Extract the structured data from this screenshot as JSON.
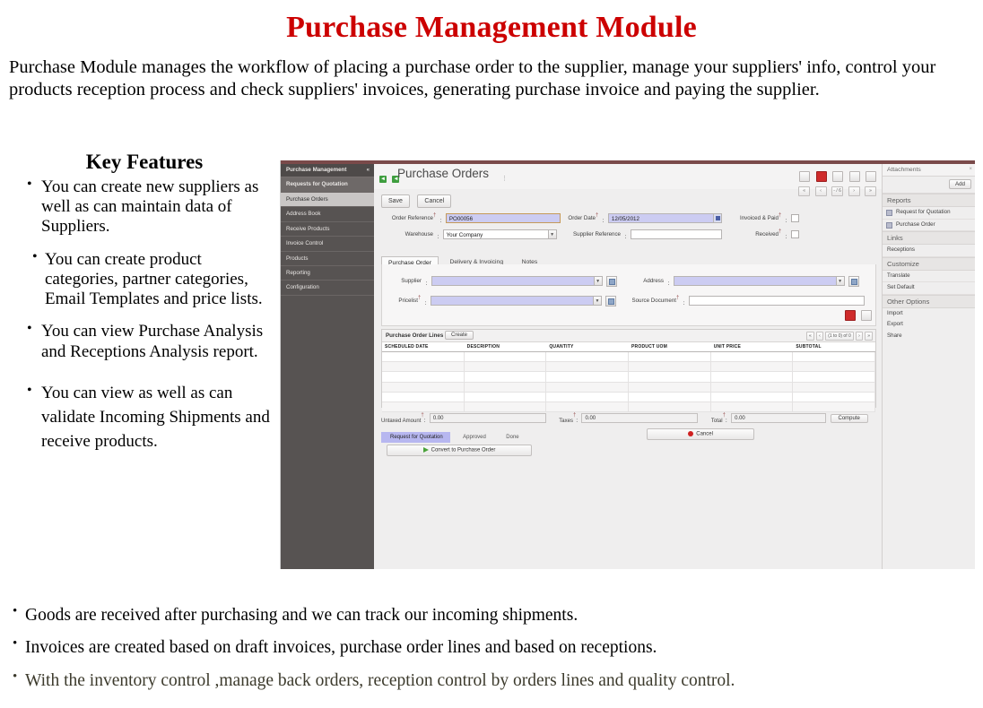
{
  "title": "Purchase Management Module",
  "intro": "Purchase Module manages the workflow of placing a purchase order to the supplier, manage your suppliers' info, control your products reception process and check suppliers' invoices, generating purchase invoice and paying the supplier.",
  "key_features": {
    "heading": "Key Features",
    "items": [
      "You can create new suppliers as well as can maintain data of Suppliers.",
      "You can create product categories, partner categories, Email Templates and price lists.",
      "You can view Purchase Analysis and Receptions  Analysis report.",
      "You can view as well as can validate Incoming Shipments and receive products."
    ]
  },
  "bottom_points": [
    "Goods are received after purchasing and we can track our incoming shipments.",
    "Invoices are created based on draft invoices, purchase order lines and based on receptions.",
    "With the inventory control ,manage back orders, reception control by orders lines and quality control."
  ],
  "colors": {
    "title_red": "#cc0000",
    "olive_text": "#3c3a2c",
    "erp_sidebar": "#575352",
    "erp_topbar": "#7a4a4a",
    "active_view": "#cf2b2b",
    "field_lilac": "#ccccf2",
    "status_active": "#b7b7f0"
  },
  "erp": {
    "sidebar": {
      "header": "Purchase Management",
      "collapse_icon": "chevron-left-icon",
      "selected": "Requests for Quotation",
      "highlight": "Purchase Orders",
      "items": [
        "Requests for Quotation",
        "Purchase Orders",
        "Address Book",
        "Receive Products",
        "Invoice Control",
        "Products",
        "Reporting",
        "Configuration"
      ]
    },
    "header": {
      "title": "Purchase Orders",
      "breadcrumb_dots": "",
      "view_buttons": [
        "list-view-icon",
        "form-view-icon",
        "calendar-view-icon",
        "graph-view-icon",
        "gantt-view-icon"
      ],
      "active_view_index": 1,
      "nav_buttons": [
        "«",
        "‹",
        "- / 6",
        "›",
        "»"
      ]
    },
    "toolbar": {
      "save": "Save",
      "cancel": "Cancel"
    },
    "form": {
      "order_reference": {
        "label": "Order Reference",
        "required": true,
        "value": "PO00056"
      },
      "order_date": {
        "label": "Order Date",
        "required": true,
        "value": "12/05/2012"
      },
      "invoiced_paid": {
        "label": "Invoiced & Paid",
        "required": true,
        "checked": false
      },
      "warehouse": {
        "label": "Warehouse",
        "required": false,
        "value": "Your Company"
      },
      "supplier_reference": {
        "label": "Supplier Reference",
        "required": false,
        "value": ""
      },
      "received": {
        "label": "Received",
        "required": true,
        "checked": false
      }
    },
    "tabs": [
      {
        "label": "Purchase Order",
        "active": true
      },
      {
        "label": "Delivery & Invoicing",
        "active": false
      },
      {
        "label": "Notes",
        "active": false
      }
    ],
    "panel": {
      "supplier": {
        "label": "Supplier",
        "required": false,
        "value": ""
      },
      "pricelist": {
        "label": "Pricelist",
        "required": true,
        "value": ""
      },
      "address": {
        "label": "Address",
        "required": false,
        "value": ""
      },
      "source_document": {
        "label": "Source Document",
        "required": true,
        "value": ""
      }
    },
    "lines": {
      "title": "Purchase Order Lines",
      "create_label": "Create",
      "pager": "(1 to 0) of 0",
      "columns": [
        "SCHEDULED DATE",
        "DESCRIPTION",
        "QUANTITY",
        "PRODUCT UOM",
        "UNIT PRICE",
        "SUBTOTAL"
      ],
      "rows": []
    },
    "totals": {
      "untaxed": {
        "label": "Untaxed Amount",
        "required": true,
        "value": "0.00"
      },
      "taxes": {
        "label": "Taxes",
        "required": true,
        "value": "0.00"
      },
      "total": {
        "label": "Total",
        "required": true,
        "value": "0.00"
      },
      "compute": "Compute"
    },
    "statusbar": {
      "states": [
        "Request for Quotation",
        "Approved",
        "Done"
      ],
      "active": "Request for Quotation",
      "cancel": "Cancel",
      "convert": "Convert to Purchase Order"
    },
    "right_panel": {
      "attachments": {
        "title": "Attachments",
        "close_icon": "close-icon",
        "add": "Add"
      },
      "sections": [
        {
          "title": "Reports",
          "items": [
            "Request for Quotation",
            "Purchase Order"
          ],
          "icons": true
        },
        {
          "title": "Links",
          "items": [
            "Receptions"
          ],
          "icons": false
        },
        {
          "title": "Customize",
          "items": [
            "Translate",
            "Set Default"
          ],
          "icons": false
        },
        {
          "title": "Other Options",
          "items": [
            "Import",
            "Export",
            "Share"
          ],
          "icons": false
        }
      ]
    }
  }
}
